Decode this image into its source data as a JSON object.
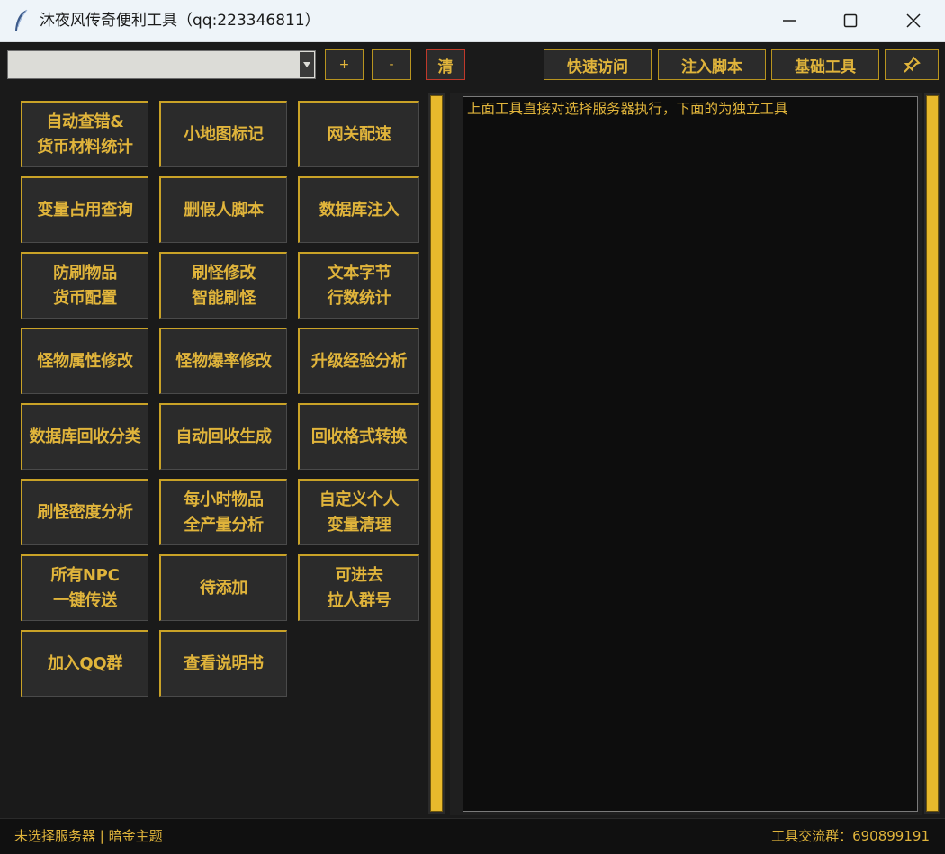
{
  "window": {
    "title": "沐夜风传奇便利工具（qq:223346811）",
    "icons": {
      "app": "feather-icon",
      "minimize": "minimize-icon",
      "maximize": "maximize-icon",
      "close": "close-icon"
    }
  },
  "toolbar": {
    "server_select_value": "",
    "add_label": "+",
    "remove_label": "-",
    "clear_label": "清",
    "quick_access_label": "快速访问",
    "inject_script_label": "注入脚本",
    "basic_tools_label": "基础工具",
    "pin_icon": "pin-icon"
  },
  "tools": [
    {
      "label": "自动查错&\n货币材料统计"
    },
    {
      "label": "小地图标记"
    },
    {
      "label": "网关配速"
    },
    {
      "label": "变量占用查询"
    },
    {
      "label": "删假人脚本"
    },
    {
      "label": "数据库注入"
    },
    {
      "label": "防刷物品\n货币配置"
    },
    {
      "label": "刷怪修改\n智能刷怪"
    },
    {
      "label": "文本字节\n行数统计"
    },
    {
      "label": "怪物属性修改"
    },
    {
      "label": "怪物爆率修改"
    },
    {
      "label": "升级经验分析"
    },
    {
      "label": "数据库回收分类"
    },
    {
      "label": "自动回收生成"
    },
    {
      "label": "回收格式转换"
    },
    {
      "label": "刷怪密度分析"
    },
    {
      "label": "每小时物品\n全产量分析"
    },
    {
      "label": "自定义个人\n变量清理"
    },
    {
      "label": "所有NPC\n一键传送"
    },
    {
      "label": "待添加"
    },
    {
      "label": "可进去\n拉人群号"
    },
    {
      "label": "加入QQ群"
    },
    {
      "label": "查看说明书"
    }
  ],
  "output": {
    "text": "上面工具直接对选择服务器执行，下面的为独立工具"
  },
  "status": {
    "left": "未选择服务器 | 暗金主题",
    "right": "工具交流群：690899191"
  },
  "colors": {
    "background": "#1a1a1a",
    "accent_gold": "#e0b43b",
    "button_bg": "#2b2b2b",
    "border_gold": "#c9a227",
    "clear_border": "#c0392b",
    "scrollbar": "#e8b92c"
  }
}
